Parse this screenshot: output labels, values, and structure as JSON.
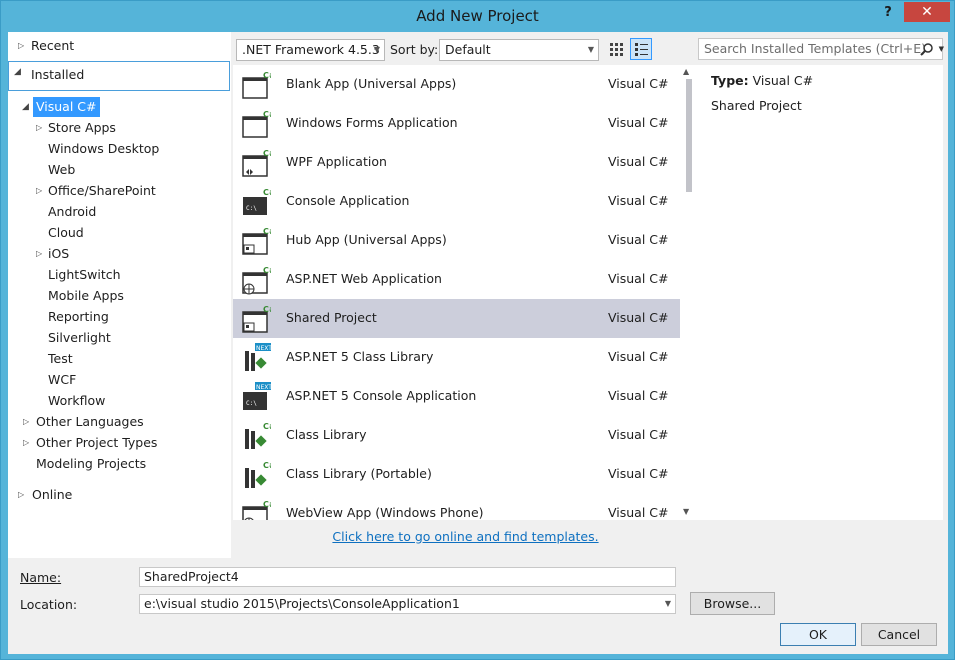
{
  "window": {
    "title": "Add New Project",
    "help_label": "?",
    "close_label": "✕"
  },
  "tree": {
    "recent": "Recent",
    "installed": "Installed",
    "visual_csharp": "Visual C#",
    "children": [
      "Store Apps",
      "Windows Desktop",
      "Web",
      "Office/SharePoint",
      "Android",
      "Cloud",
      "iOS",
      "LightSwitch",
      "Mobile Apps",
      "Reporting",
      "Silverlight",
      "Test",
      "WCF",
      "Workflow"
    ],
    "other_languages": "Other Languages",
    "other_project_types": "Other Project Types",
    "modeling_projects": "Modeling Projects",
    "online": "Online"
  },
  "toolbar": {
    "framework": ".NET Framework 4.5.3",
    "sort_by_label": "Sort by:",
    "sort_value": "Default",
    "search_placeholder": "Search Installed Templates (Ctrl+E)"
  },
  "templates": [
    {
      "name": "Blank App (Universal Apps)",
      "lang": "Visual C#",
      "icon": "universal-app-icon"
    },
    {
      "name": "Windows Forms Application",
      "lang": "Visual C#",
      "icon": "windows-forms-icon"
    },
    {
      "name": "WPF Application",
      "lang": "Visual C#",
      "icon": "wpf-icon"
    },
    {
      "name": "Console Application",
      "lang": "Visual C#",
      "icon": "console-icon"
    },
    {
      "name": "Hub App (Universal Apps)",
      "lang": "Visual C#",
      "icon": "hub-app-icon"
    },
    {
      "name": "ASP.NET Web Application",
      "lang": "Visual C#",
      "icon": "web-app-icon"
    },
    {
      "name": "Shared Project",
      "lang": "Visual C#",
      "icon": "shared-project-icon"
    },
    {
      "name": "ASP.NET 5 Class Library",
      "lang": "Visual C#",
      "icon": "class-library-next-icon"
    },
    {
      "name": "ASP.NET 5 Console Application",
      "lang": "Visual C#",
      "icon": "console-next-icon"
    },
    {
      "name": "Class Library",
      "lang": "Visual C#",
      "icon": "class-library-icon"
    },
    {
      "name": "Class Library (Portable)",
      "lang": "Visual C#",
      "icon": "portable-library-icon"
    },
    {
      "name": "WebView App (Windows Phone)",
      "lang": "Visual C#",
      "icon": "webview-icon"
    }
  ],
  "selected_template_index": 6,
  "details": {
    "type_label": "Type:",
    "type_value": "Visual C#",
    "description": "Shared Project"
  },
  "online_link": "Click here to go online and find templates.",
  "form": {
    "name_label": "Name:",
    "name_value": "SharedProject4",
    "location_label": "Location:",
    "location_value": "e:\\visual studio 2015\\Projects\\ConsoleApplication1",
    "browse_label": "Browse...",
    "ok_label": "OK",
    "cancel_label": "Cancel"
  },
  "colors": {
    "title_bar": "#55b4d9",
    "close_button": "#c7463f",
    "selection": "#3399ff",
    "selected_row": "#cccedb",
    "link": "#0e70c0",
    "csharp_badge": "#388a34"
  }
}
